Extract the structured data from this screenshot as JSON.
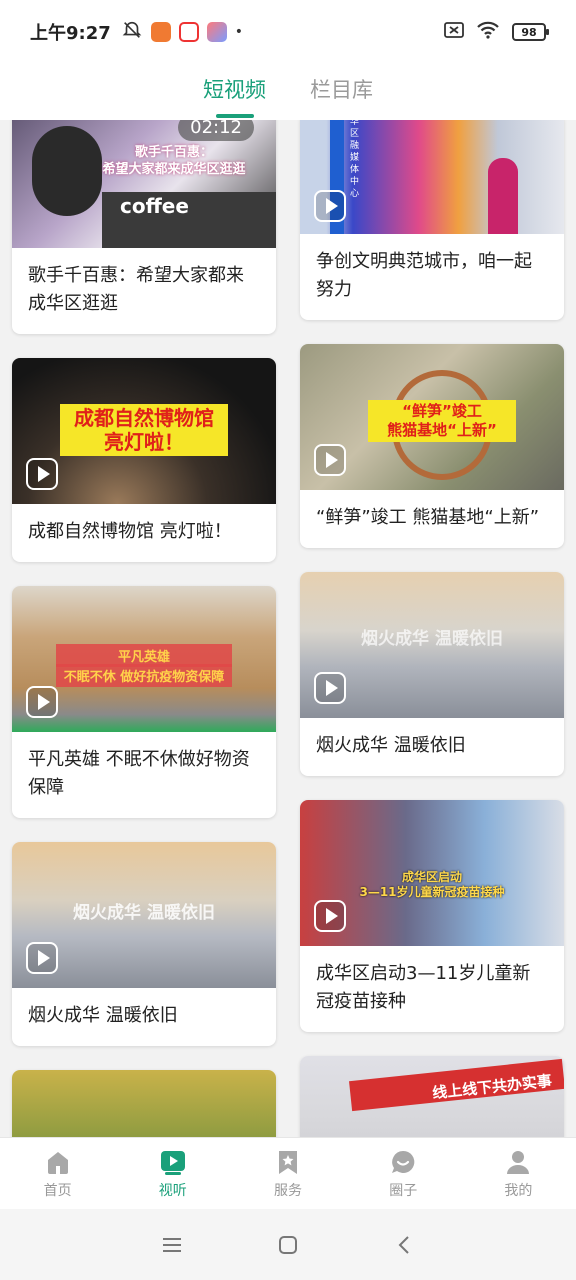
{
  "status_bar": {
    "time": "上午9:27",
    "battery": "98"
  },
  "tabs": [
    {
      "label": "短视频",
      "active": true
    },
    {
      "label": "栏目库",
      "active": false
    }
  ],
  "videos": {
    "left": [
      {
        "title": "歌手千百惠：希望大家都来成华区逛逛",
        "duration": "02:12",
        "overlay": "歌手千百惠：\n希望大家都来成华区逛逛",
        "thumb_text": "coffee"
      },
      {
        "title": "成都自然博物馆  亮灯啦！",
        "overlay": "成都自然博物馆\n亮灯啦！"
      },
      {
        "title": "平凡英雄 不眠不休做好物资保障",
        "overlay_a": "平凡英雄",
        "overlay_b": "不眠不休 做好抗疫物资保障"
      },
      {
        "title": "烟火成华 温暖依旧",
        "overlay": "烟火成华 温暖依旧"
      },
      {
        "title": ""
      }
    ],
    "right": [
      {
        "title": "争创文明典范城市，咱一起努力",
        "overlay": "华区融媒体中心"
      },
      {
        "title": "“鲜笋”竣工 熊猫基地“上新”",
        "overlay": "“鲜笋”竣工\n熊猫基地“上新”"
      },
      {
        "title": "烟火成华 温暖依旧",
        "overlay": "烟火成华 温暖依旧"
      },
      {
        "title": "成华区启动3—11岁儿童新冠疫苗接种",
        "overlay": "成华区启动\n3—11岁儿童新冠疫苗接种"
      },
      {
        "title": "",
        "overlay": "线上线下共办实事"
      }
    ]
  },
  "bottom_nav": [
    {
      "label": "首页",
      "icon": "home-icon",
      "active": false
    },
    {
      "label": "视听",
      "icon": "video-icon",
      "active": true
    },
    {
      "label": "服务",
      "icon": "bookmark-star-icon",
      "active": false
    },
    {
      "label": "圈子",
      "icon": "chat-bubble-icon",
      "active": false
    },
    {
      "label": "我的",
      "icon": "user-icon",
      "active": false
    }
  ],
  "colors": {
    "accent": "#1aa07a",
    "inactive": "#999999"
  }
}
